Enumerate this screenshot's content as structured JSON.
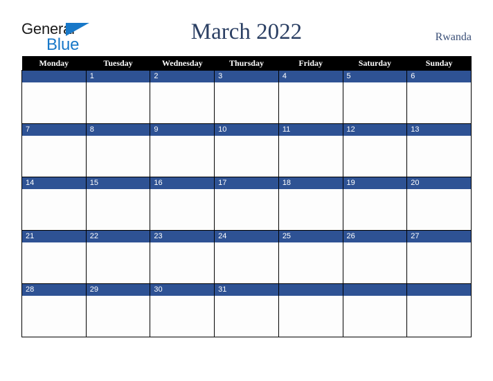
{
  "logo": {
    "word_one": "General",
    "word_two": "Blue",
    "triangle_icon": "blue-triangle-icon",
    "blue_hex": "#1878c8",
    "text_hex": "#1b1b1b"
  },
  "header": {
    "title": "March 2022",
    "country": "Rwanda",
    "title_color": "#2b3f63"
  },
  "calendar": {
    "month": "March",
    "year": "2022",
    "week_start": "Monday",
    "header_bg": "#000000",
    "header_fg": "#ffffff",
    "day_band_bg": "#2e5294",
    "day_band_fg": "#ffffff",
    "cell_bg": "#fdfdfd",
    "grid_line": "#000000",
    "weekdays": [
      "Monday",
      "Tuesday",
      "Wednesday",
      "Thursday",
      "Friday",
      "Saturday",
      "Sunday"
    ],
    "weeks": [
      [
        "",
        "1",
        "2",
        "3",
        "4",
        "5",
        "6"
      ],
      [
        "7",
        "8",
        "9",
        "10",
        "11",
        "12",
        "13"
      ],
      [
        "14",
        "15",
        "16",
        "17",
        "18",
        "19",
        "20"
      ],
      [
        "21",
        "22",
        "23",
        "24",
        "25",
        "26",
        "27"
      ],
      [
        "28",
        "29",
        "30",
        "31",
        "",
        "",
        ""
      ]
    ]
  }
}
